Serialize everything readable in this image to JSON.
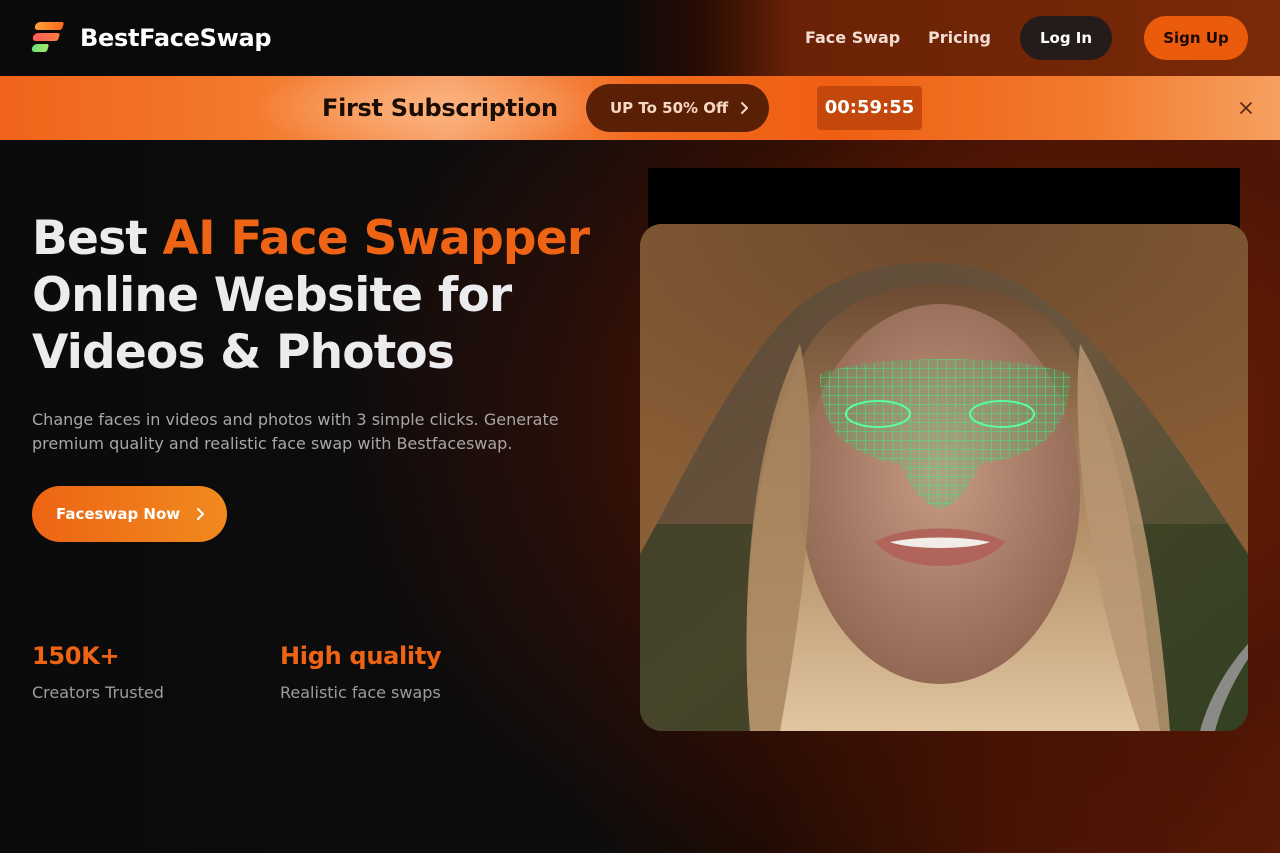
{
  "header": {
    "brand": "BestFaceSwap",
    "logo_icon": "stacked-bars-logo-icon",
    "nav": [
      {
        "label": "Face Swap"
      },
      {
        "label": "Pricing"
      }
    ],
    "login_label": "Log In",
    "signup_label": "Sign Up",
    "colors": {
      "accent": "#ea5b0c",
      "login_bg": "#241c1a"
    }
  },
  "promo": {
    "title": "First Subscription",
    "offer_label": "UP To 50% Off",
    "offer_icon": "chevron-right-icon",
    "timer": "00:59:55",
    "close_icon": "close-icon"
  },
  "hero": {
    "title_plain_1": "Best ",
    "title_accent": "AI Face Swapper",
    "title_line_2": "Online Website for",
    "title_line_3": "Videos & Photos",
    "description": "Change faces in videos and photos with 3 simple clicks. Generate premium quality and realistic face swap with Bestfaceswap.",
    "cta_label": "Faceswap Now",
    "cta_icon": "chevron-right-icon"
  },
  "stats": [
    {
      "value": "150K+",
      "label": "Creators Trusted"
    },
    {
      "value": "High quality",
      "label": "Realistic face swaps"
    }
  ],
  "media": {
    "description_icon": "face-mesh-demo-image"
  }
}
